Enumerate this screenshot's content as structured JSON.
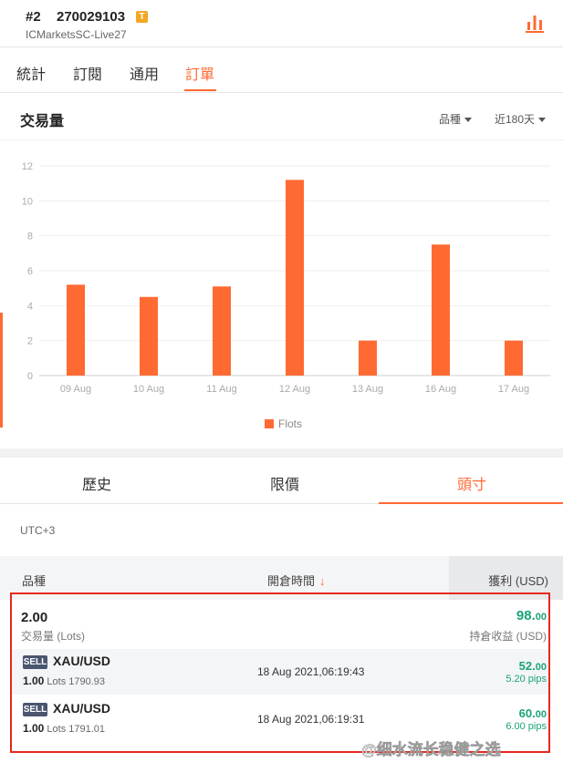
{
  "account": {
    "rank": "#2",
    "id": "270029103",
    "badge": "T",
    "server": "ICMarketsSC-Live27"
  },
  "tabs": [
    {
      "label": "統計",
      "active": false
    },
    {
      "label": "訂閱",
      "active": false
    },
    {
      "label": "通用",
      "active": false
    },
    {
      "label": "訂單",
      "active": true
    }
  ],
  "volume": {
    "title": "交易量",
    "filter_symbol": "品種",
    "filter_period": "近180天"
  },
  "chart_data": {
    "type": "bar",
    "categories": [
      "09 Aug",
      "10 Aug",
      "11 Aug",
      "12 Aug",
      "13 Aug",
      "16 Aug",
      "17 Aug"
    ],
    "series": [
      {
        "name": "Flots",
        "values": [
          5.2,
          4.5,
          5.1,
          11.2,
          2.0,
          7.5,
          2.0
        ],
        "color": "#ff6a33"
      }
    ],
    "yticks": [
      0,
      2,
      4,
      6,
      8,
      10,
      12
    ],
    "ylim": [
      0,
      12
    ],
    "grid": true,
    "legend": "bottom-center"
  },
  "position_tabs": [
    {
      "label": "歷史",
      "active": false
    },
    {
      "label": "限價",
      "active": false
    },
    {
      "label": "頭寸",
      "active": true
    }
  ],
  "timezone": "UTC+3",
  "columns": {
    "symbol": "品種",
    "open_time": "開倉時間",
    "sort_arrow": "↓",
    "profit": "獲利 (USD)"
  },
  "summary": {
    "lots": "2.00",
    "lots_label": "交易量 (Lots)",
    "profit_int": "98.",
    "profit_dec": "00",
    "profit_label": "持倉收益 (USD)"
  },
  "trades": [
    {
      "side": "SELL",
      "symbol": "XAU/USD",
      "lots": "1.00",
      "lots_word": "Lots",
      "price": "1790.93",
      "time": "18 Aug 2021,06:19:43",
      "profit_int": "52.",
      "profit_dec": "00",
      "pips": "5.20 pips"
    },
    {
      "side": "SELL",
      "symbol": "XAU/USD",
      "lots": "1.00",
      "lots_word": "Lots",
      "price": "1791.01",
      "time": "18 Aug 2021,06:19:31",
      "profit_int": "60.",
      "profit_dec": "00",
      "pips": "6.00 pips"
    }
  ],
  "watermark": "@细水流长稳健之选",
  "colors": {
    "accent": "#ff6a33",
    "profit": "#1aa37a",
    "sell_badge": "#4a5670",
    "frame": "#e8271d"
  }
}
